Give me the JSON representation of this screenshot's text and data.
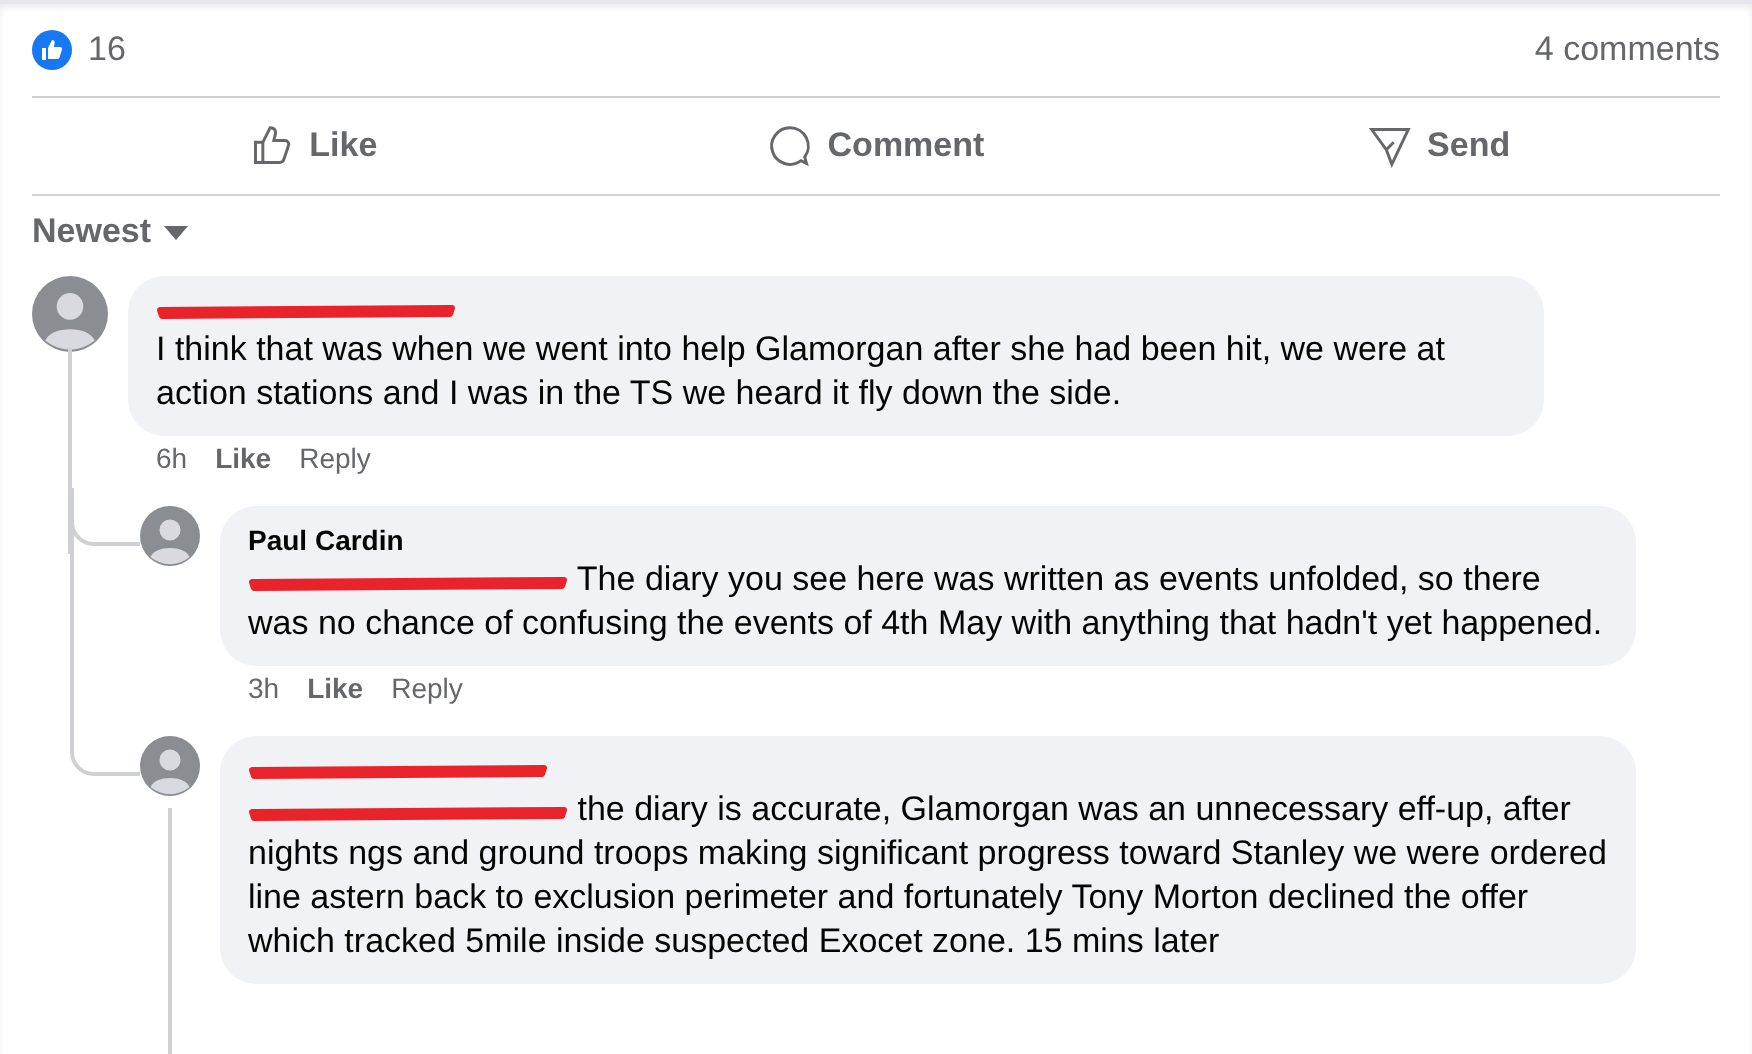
{
  "reactions": {
    "count": "16",
    "comments": "4 comments"
  },
  "actions": [
    {
      "kind": "like",
      "label": "Like"
    },
    {
      "kind": "comment",
      "label": "Comment"
    },
    {
      "kind": "send",
      "label": "Send"
    }
  ],
  "sort": {
    "label": "Newest"
  },
  "comments": [
    {
      "name_redacted": true,
      "mention_redacted": false,
      "text": "I think that was when we went into help Glamorgan after she had been hit, we were at action stations and I was in the TS we heard it fly down the side.",
      "time": "6h",
      "like": "Like",
      "reply": "Reply",
      "replies": [
        {
          "name": "Paul Cardin",
          "name_redacted": false,
          "mention_redacted": true,
          "text": "The diary you see here was written as events unfolded, so there was no chance of confusing the events of 4th May with anything that hadn't yet happened.",
          "time": "3h",
          "like": "Like",
          "reply": "Reply",
          "has_replies": false
        },
        {
          "name_redacted": true,
          "mention_redacted": true,
          "text": "the diary is accurate, Glamorgan was an unnecessary eff-up, after nights ngs and ground troops making significant progress toward Stanley we were ordered line astern back to exclusion perimeter and fortunately Tony Morton declined the offer which tracked 5mile inside suspected Exocet zone. 15 mins later",
          "has_replies": true
        }
      ]
    }
  ]
}
